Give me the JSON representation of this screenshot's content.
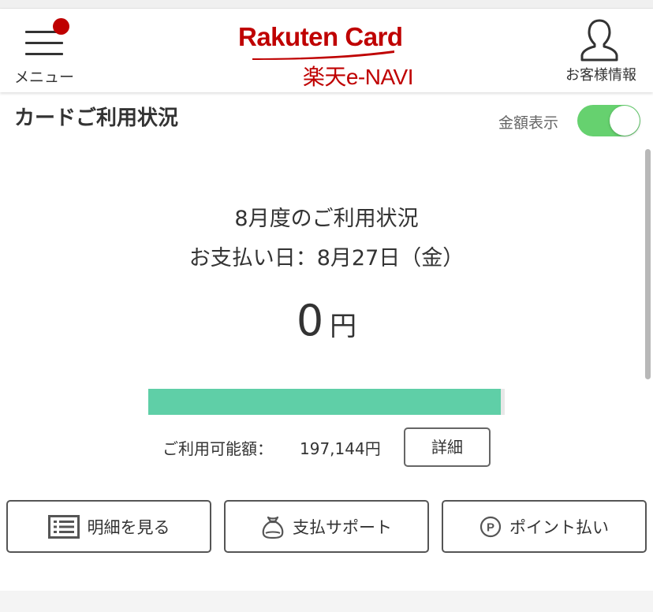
{
  "header": {
    "menu_label": "メニュー",
    "logo_top": "Rakuten Card",
    "logo_bottom": "楽天e-NAVI",
    "account_label": "お客様情報"
  },
  "section": {
    "title": "カードご利用状況",
    "amount_toggle_label": "金額表示",
    "amount_toggle_on": true
  },
  "summary": {
    "period": "8月度のご利用状況",
    "payment_date": "お支払い日：8月27日（金）",
    "amount": "0",
    "currency": "円",
    "usage_ratio": 0.99,
    "available_label": "ご利用可能額：",
    "available_amount": "197,144円",
    "detail_button": "詳細"
  },
  "actions": {
    "statement": "明細を見る",
    "support": "支払サポート",
    "points": "ポイント払い"
  },
  "colors": {
    "brand": "#bf0000",
    "toggle_on": "#66d16f",
    "bar_fill": "#5fcfa7"
  }
}
